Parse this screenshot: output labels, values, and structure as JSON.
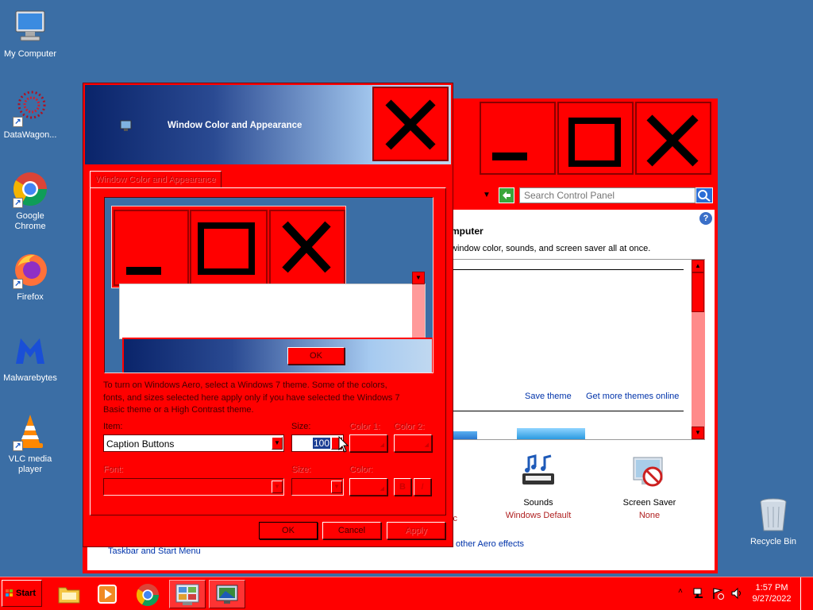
{
  "desktop": {
    "icons": [
      {
        "label": "My Computer"
      },
      {
        "label": "DataWagon..."
      },
      {
        "label": "Google Chrome"
      },
      {
        "label": "Firefox"
      },
      {
        "label": "Malwarebytes"
      },
      {
        "label": "VLC media player"
      },
      {
        "label": "Recycle Bin"
      }
    ]
  },
  "control_panel": {
    "search_placeholder": "Search Control Panel",
    "heading_partial": "mputer",
    "description_partial": "window color, sounds, and screen saver all at once.",
    "save_theme": "Save theme",
    "get_more_themes": "Get more themes online",
    "sounds_label": "Sounds",
    "sounds_value": "Windows Default",
    "screensaver_label": "Screen Saver",
    "screensaver_value": "None",
    "partial_left_text": "ic",
    "taskbar_link": "Taskbar and Start Menu",
    "aero_link": "other Aero effects"
  },
  "dialog": {
    "title": "Window Color and Appearance",
    "tab_label": "Window Color and Appearance",
    "preview_ok": "OK",
    "info_text_line1": "To turn on Windows Aero, select a Windows 7 theme.  Some of the colors,",
    "info_text_line2": "fonts, and sizes selected here apply only if you have selected the Windows 7",
    "info_text_line3": "Basic theme or a High Contrast theme.",
    "item_label": "Item:",
    "item_value": "Caption Buttons",
    "size_label": "Size:",
    "size_value": "100",
    "color1_label": "Color 1:",
    "color2_label": "Color 2:",
    "font_label": "Font:",
    "font_size_label": "Size:",
    "font_color_label": "Color:",
    "bold_label": "B",
    "italic_label": "I",
    "ok_label": "OK",
    "cancel_label": "Cancel",
    "apply_label": "Apply"
  },
  "taskbar": {
    "start_label": "Start",
    "time": "1:57 PM",
    "date": "9/27/2022"
  },
  "colors": {
    "desktop": "#3b6ea5",
    "theme_red": "#ff0000",
    "title_gradient_start": "#0a246a",
    "title_gradient_end": "#a6caf0"
  }
}
